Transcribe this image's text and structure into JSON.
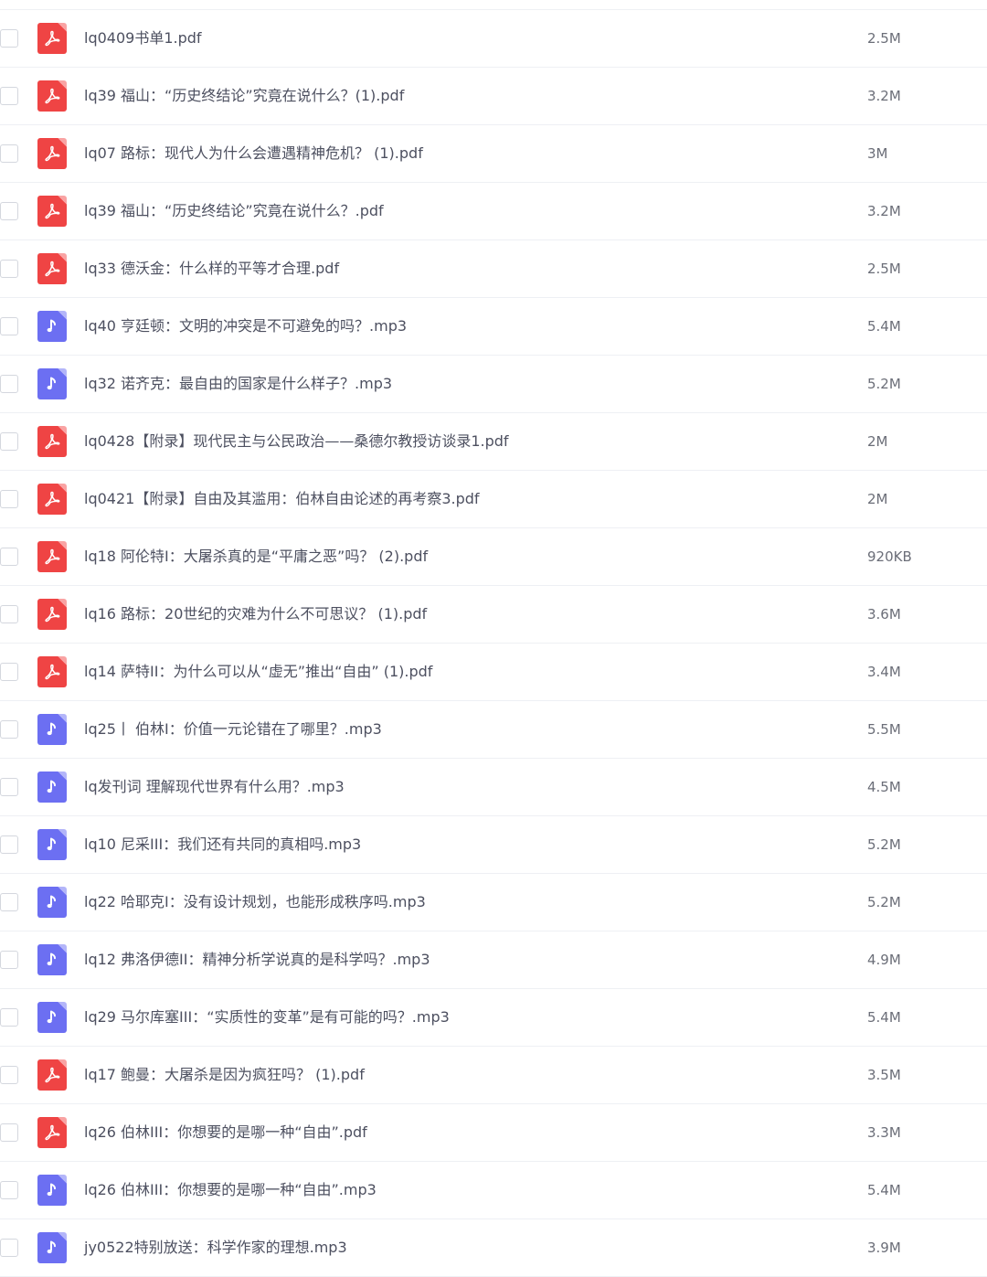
{
  "colors": {
    "pdf_icon": "#ef4444",
    "audio_icon": "#6c6ff2",
    "row_divider": "#eef0f4",
    "name_text": "#4d5060",
    "size_text": "#6b6e78"
  },
  "files": [
    {
      "name": "lq0409书单1.pdf",
      "size": "2.5M",
      "type": "pdf",
      "icon": "pdf-icon"
    },
    {
      "name": "lq39 福山：“历史终结论”究竟在说什么？(1).pdf",
      "size": "3.2M",
      "type": "pdf",
      "icon": "pdf-icon"
    },
    {
      "name": "lq07 路标：现代人为什么会遭遇精神危机？ (1).pdf",
      "size": "3M",
      "type": "pdf",
      "icon": "pdf-icon"
    },
    {
      "name": "lq39 福山：“历史终结论”究竟在说什么？.pdf",
      "size": "3.2M",
      "type": "pdf",
      "icon": "pdf-icon"
    },
    {
      "name": "lq33 德沃金：什么样的平等才合理.pdf",
      "size": "2.5M",
      "type": "pdf",
      "icon": "pdf-icon"
    },
    {
      "name": "lq40 亨廷顿：文明的冲突是不可避免的吗？.mp3",
      "size": "5.4M",
      "type": "mp3",
      "icon": "audio-icon"
    },
    {
      "name": "lq32 诺齐克：最自由的国家是什么样子？.mp3",
      "size": "5.2M",
      "type": "mp3",
      "icon": "audio-icon"
    },
    {
      "name": "lq0428【附录】现代民主与公民政治——桑德尔教授访谈录1.pdf",
      "size": "2M",
      "type": "pdf",
      "icon": "pdf-icon"
    },
    {
      "name": "lq0421【附录】自由及其滥用：伯林自由论述的再考察3.pdf",
      "size": "2M",
      "type": "pdf",
      "icon": "pdf-icon"
    },
    {
      "name": "lq18 阿伦特I：大屠杀真的是“平庸之恶”吗？ (2).pdf",
      "size": "920KB",
      "type": "pdf",
      "icon": "pdf-icon"
    },
    {
      "name": "lq16 路标：20世纪的灾难为什么不可思议？ (1).pdf",
      "size": "3.6M",
      "type": "pdf",
      "icon": "pdf-icon"
    },
    {
      "name": "lq14 萨特II：为什么可以从“虚无”推出“自由” (1).pdf",
      "size": "3.4M",
      "type": "pdf",
      "icon": "pdf-icon"
    },
    {
      "name": "lq25丨 伯林I：价值一元论错在了哪里？.mp3",
      "size": "5.5M",
      "type": "mp3",
      "icon": "audio-icon"
    },
    {
      "name": "lq发刊词 理解现代世界有什么用？.mp3",
      "size": "4.5M",
      "type": "mp3",
      "icon": "audio-icon"
    },
    {
      "name": "lq10 尼采III：我们还有共同的真相吗.mp3",
      "size": "5.2M",
      "type": "mp3",
      "icon": "audio-icon"
    },
    {
      "name": "lq22 哈耶克I：没有设计规划，也能形成秩序吗.mp3",
      "size": "5.2M",
      "type": "mp3",
      "icon": "audio-icon"
    },
    {
      "name": "lq12 弗洛伊德II：精神分析学说真的是科学吗？.mp3",
      "size": "4.9M",
      "type": "mp3",
      "icon": "audio-icon"
    },
    {
      "name": "lq29 马尔库塞III：“实质性的变革”是有可能的吗？.mp3",
      "size": "5.4M",
      "type": "mp3",
      "icon": "audio-icon"
    },
    {
      "name": "lq17 鲍曼：大屠杀是因为疯狂吗？ (1).pdf",
      "size": "3.5M",
      "type": "pdf",
      "icon": "pdf-icon"
    },
    {
      "name": "lq26 伯林III：你想要的是哪一种“自由”.pdf",
      "size": "3.3M",
      "type": "pdf",
      "icon": "pdf-icon"
    },
    {
      "name": "lq26 伯林III：你想要的是哪一种“自由”.mp3",
      "size": "5.4M",
      "type": "mp3",
      "icon": "audio-icon"
    },
    {
      "name": "jy0522特别放送：科学作家的理想.mp3",
      "size": "3.9M",
      "type": "mp3",
      "icon": "audio-icon"
    }
  ]
}
